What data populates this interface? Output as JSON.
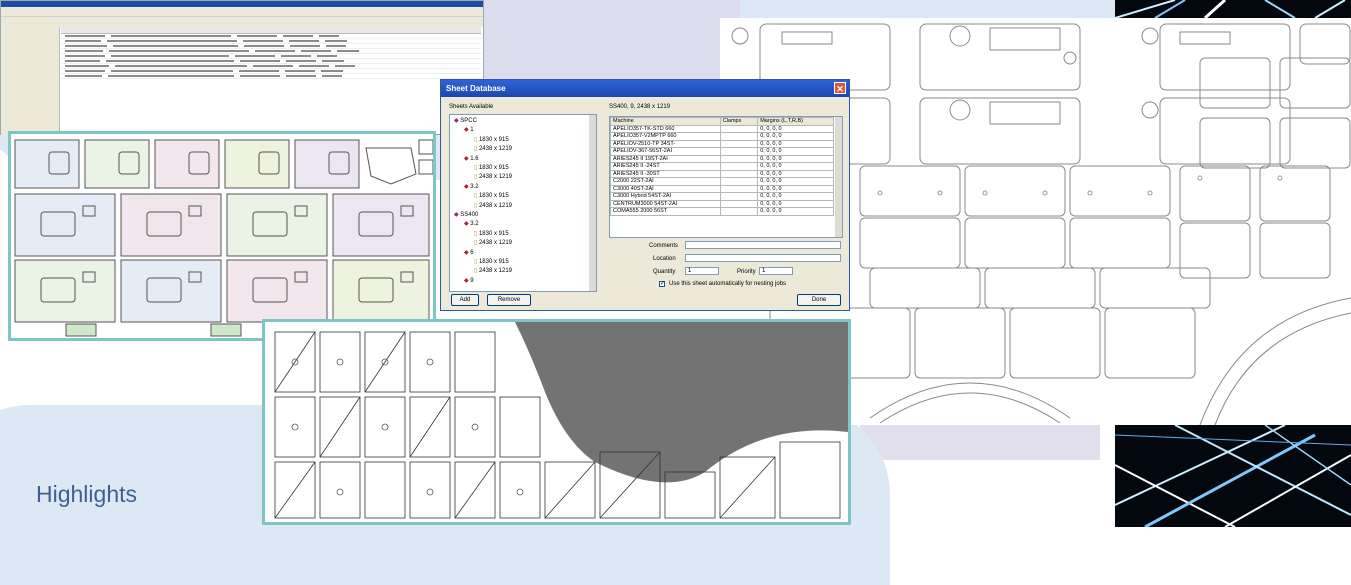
{
  "caption": "Highlights",
  "dialog": {
    "title": "Sheet Database",
    "sheets_available_label": "Sheets Available",
    "selected_sheet": "SS400, 9, 2438 x 1219",
    "tree": [
      {
        "label": "SPCC",
        "level": 0
      },
      {
        "label": "1",
        "level": 1
      },
      {
        "label": "1830 x 915",
        "level": 2
      },
      {
        "label": "2438 x 1219",
        "level": 2
      },
      {
        "label": "1.6",
        "level": 1
      },
      {
        "label": "1830 x 915",
        "level": 2
      },
      {
        "label": "2438 x 1219",
        "level": 2
      },
      {
        "label": "3.2",
        "level": 1
      },
      {
        "label": "1830 x 915",
        "level": 2
      },
      {
        "label": "2438 x 1219",
        "level": 2
      },
      {
        "label": "SS400",
        "level": 0
      },
      {
        "label": "3.2",
        "level": 1
      },
      {
        "label": "1830 x 915",
        "level": 2
      },
      {
        "label": "2438 x 1219",
        "level": 2
      },
      {
        "label": "6",
        "level": 1
      },
      {
        "label": "1830 x 915",
        "level": 2
      },
      {
        "label": "2438 x 1219",
        "level": 2
      },
      {
        "label": "9",
        "level": 1
      }
    ],
    "columns": [
      "Machine",
      "Clamps",
      "Margins (L,T,R,B)"
    ],
    "rows": [
      [
        "APELIO357-TK-STD 660",
        "",
        "0, 0, 0, 0"
      ],
      [
        "APELIO357-V2MPTP 660",
        "",
        "0, 0, 0, 0"
      ],
      [
        "APELIOV-2510-TP 34ST-",
        "",
        "0, 0, 0, 0"
      ],
      [
        "APELIOV-367-56ST-2AI",
        "",
        "0, 0, 0, 0"
      ],
      [
        "ARIES245 II 19ST-2AI",
        "",
        "0, 0, 0, 0"
      ],
      [
        "ARIES245 II -24ST",
        "",
        "0, 0, 0, 0"
      ],
      [
        "ARIES245 II -30ST",
        "",
        "0, 0, 0, 0"
      ],
      [
        "C2000 22ST-2AI",
        "",
        "0, 0, 0, 0"
      ],
      [
        "C3000 40ST-2AI",
        "",
        "0, 0, 0, 0"
      ],
      [
        "C3000 Hybrid 54ST-2AI",
        "",
        "0, 0, 0, 0"
      ],
      [
        "CENTRUM3000 54ST-2AI",
        "",
        "0, 0, 0, 0"
      ],
      [
        "COMA555 2000 56ST",
        "",
        "0, 0, 0, 0"
      ]
    ],
    "comments_label": "Comments",
    "comments_value": "",
    "location_label": "Location",
    "location_value": "",
    "quantity_label": "Quantity",
    "quantity_value": "1",
    "priority_label": "Priority",
    "priority_value": "1",
    "auto_use_label": "Use this sheet automatically for nesting jobs",
    "auto_use_checked": true,
    "add_label": "Add",
    "remove_label": "Remove",
    "done_label": "Done"
  },
  "colors": {
    "accent_frame": "#7cc7c5",
    "caption": "#3f5f94",
    "title_bar": "#1c46b0",
    "blob": "#dce9f5"
  }
}
